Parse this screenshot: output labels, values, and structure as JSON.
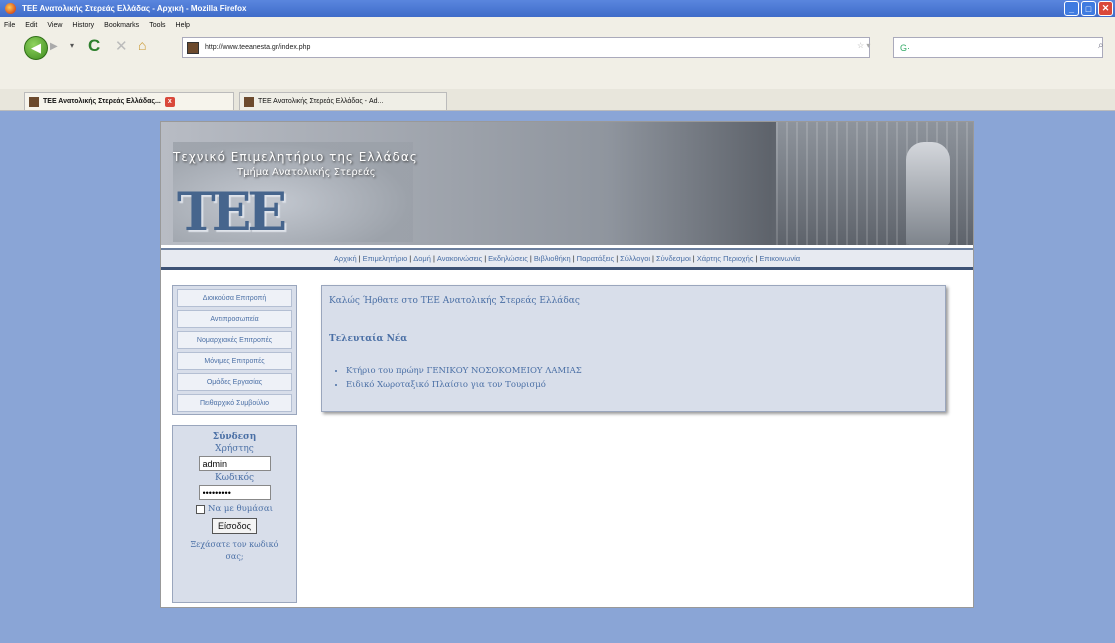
{
  "window": {
    "title": "ΤΕΕ Ανατολικής Στερεάς Ελλάδας - Αρχική - Mozilla Firefox"
  },
  "menubar": [
    "File",
    "Edit",
    "View",
    "History",
    "Bookmarks",
    "Tools",
    "Help"
  ],
  "toolbar": {
    "url": "http://www.teeanesta.gr/index.php",
    "search_engine": "G·"
  },
  "tabs": [
    {
      "label": "ΤΕΕ Ανατολικής Στερεάς Ελλάδας..."
    },
    {
      "label": "ΤΕΕ Ανατολικής Στερεάς Ελλάδας - Ad..."
    }
  ],
  "banner": {
    "title": "Τεχνικό Επιμελητήριο της Ελλάδας",
    "subtitle": "Τμήμα Ανατολικής Στερεάς",
    "logo": "ΤΕΕ"
  },
  "topnav": [
    "Αρχική",
    "Επιμελητήριο",
    "Δομή",
    "Ανακοινώσεις",
    "Εκδηλώσεις",
    "Βιβλιοθήκη",
    "Παρατάξεις",
    "Σύλλογοι",
    "Σύνδεσμοι",
    "Χάρτης Περιοχής",
    "Επικοινωνία"
  ],
  "sidemenu": [
    "Διοικούσα Επιτροπή",
    "Αντιπροσωπεία",
    "Νομαρχιακές Επιτροπές",
    "Μόνιμες Επιτροπές",
    "Ομάδες Εργασίας",
    "Πειθαρχικό Συμβούλιο"
  ],
  "login": {
    "title": "Σύνδεση",
    "username_label": "Χρήστης",
    "username_value": "admin",
    "password_label": "Κωδικός",
    "password_value": "•••••••••",
    "remember_label": "Να με θυμάσαι",
    "submit_label": "Είσοδος",
    "forgot_label": "Ξεχάσατε τον κωδικό σας;"
  },
  "content": {
    "welcome": "Καλώς Ήρθατε στο ΤΕΕ Ανατολικής Στερεάς Ελλάδας",
    "news_heading": "Τελευταία Νέα",
    "news": [
      "Κτήριο του πρώην ΓΕΝΙΚΟΥ ΝΟΣΟΚΟΜΕΙΟΥ ΛΑΜΙΑΣ",
      "Ειδικό Χωροταξικό Πλαίσιο για τον Τουρισμό"
    ]
  }
}
